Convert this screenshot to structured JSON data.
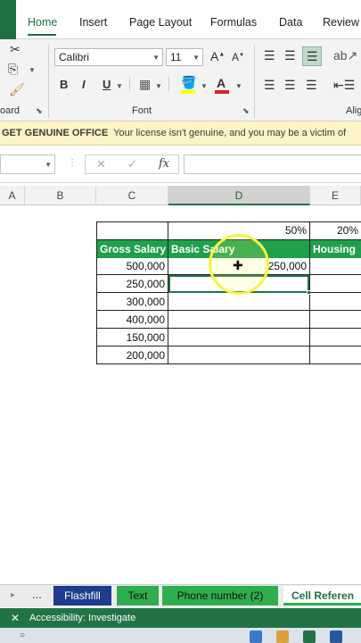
{
  "ribbon": {
    "tabs": [
      "Home",
      "Insert",
      "Page Layout",
      "Formulas",
      "Data",
      "Review"
    ],
    "active_tab": "Home",
    "font_name": "Calibri",
    "font_size": "11",
    "group_clipboard": "oard",
    "group_font": "Font",
    "group_alignment": "Alig",
    "increase_font": "A",
    "decrease_font": "A",
    "bold": "B",
    "italic": "I",
    "underline": "U",
    "font_color_letter": "A"
  },
  "message_bar": {
    "title": "GET GENUINE OFFICE",
    "text": "Your license isn't genuine, and you may be a victim of"
  },
  "formula_bar": {
    "cancel": "✕",
    "enter": "✓",
    "fx": "fx"
  },
  "columns": [
    "A",
    "B",
    "C",
    "D",
    "E"
  ],
  "table": {
    "percent_d": "50%",
    "percent_e": "20%",
    "headers": [
      "Gross Salary",
      "Basic Salary",
      "Housing"
    ],
    "gross_salary": [
      "500,000",
      "250,000",
      "300,000",
      "400,000",
      "150,000",
      "200,000"
    ],
    "basic_salary": [
      "250,000",
      "",
      "",
      "",
      "",
      ""
    ]
  },
  "sheet_tabs": {
    "more": "...",
    "tabs": [
      {
        "label": "Flashfill",
        "color": "#1f3b8c"
      },
      {
        "label": "Text",
        "color": "#2fae4f"
      },
      {
        "label": "Phone number (2)",
        "color": "#2fae4f"
      },
      {
        "label": "Cell Referen",
        "color": "#ffffff"
      }
    ]
  },
  "status": {
    "accessibility": "Accessibility: Investigate"
  },
  "colors": {
    "excel_green": "#217346",
    "header_fill": "#1fa04a",
    "highlight_ring": "#f5f542"
  }
}
